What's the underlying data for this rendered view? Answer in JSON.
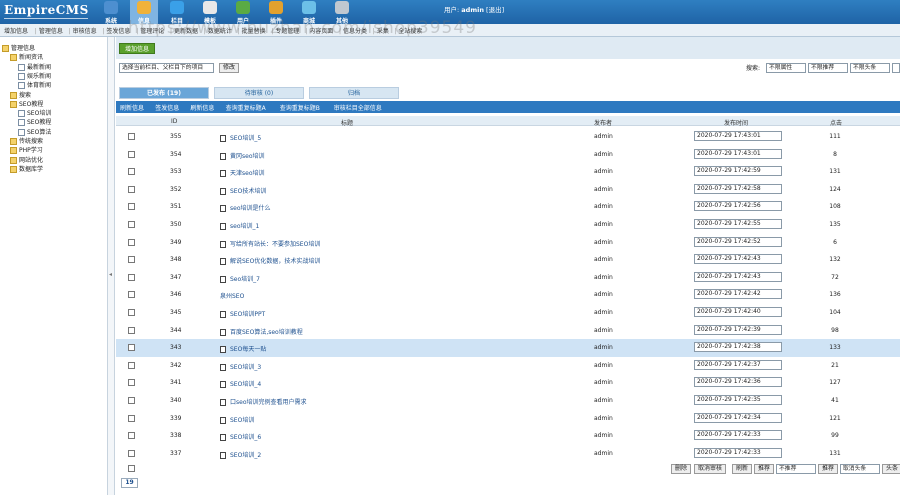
{
  "app": {
    "logo": "EmpireCMS",
    "watermark": "https://www.huzhan.com/ishop39549"
  },
  "nav": [
    {
      "label": "系统",
      "icon": "system-icon",
      "color": "#4d8fd0"
    },
    {
      "label": "信息",
      "icon": "info-edit-icon",
      "color": "#f0b23a"
    },
    {
      "label": "栏目",
      "icon": "column-icon",
      "color": "#3aa0e8"
    },
    {
      "label": "模板",
      "icon": "template-icon",
      "color": "#e8e8e8"
    },
    {
      "label": "用户",
      "icon": "user-icon",
      "color": "#5aaa44"
    },
    {
      "label": "插件",
      "icon": "plugin-icon",
      "color": "#e2a12e"
    },
    {
      "label": "商城",
      "icon": "shop-icon",
      "color": "#6cc0e8"
    },
    {
      "label": "其他",
      "icon": "other-icon",
      "color": "#c0c8d0"
    }
  ],
  "user": {
    "prefix": "用户:",
    "name": "admin",
    "logout": "[退出]"
  },
  "subtabs": [
    "增加信息",
    "管理信息",
    "审核信息",
    "签发信息",
    "管理评论",
    "更新数据",
    "数据统计",
    "批量替换",
    "专题管理",
    "内容页面",
    "信息分类",
    "采集",
    "全站搜索"
  ],
  "sidebar": [
    {
      "label": "管理信息",
      "level": 0,
      "icon": "manage-icon"
    },
    {
      "label": "新闻资讯",
      "level": 1,
      "icon": "folder-icon"
    },
    {
      "label": "最新新闻",
      "level": 2,
      "icon": "doc-icon"
    },
    {
      "label": "娱乐新闻",
      "level": 2,
      "icon": "doc-icon"
    },
    {
      "label": "体育新闻",
      "level": 2,
      "icon": "doc-icon"
    },
    {
      "label": "搜索",
      "level": 1,
      "icon": "folder-icon"
    },
    {
      "label": "SEO教程",
      "level": 1,
      "icon": "folder-icon"
    },
    {
      "label": "SEO培训",
      "level": 2,
      "icon": "doc-icon"
    },
    {
      "label": "SEO教程",
      "level": 2,
      "icon": "doc-icon"
    },
    {
      "label": "SEO算法",
      "level": 2,
      "icon": "doc-icon"
    },
    {
      "label": "传统搜索",
      "level": 1,
      "icon": "folder-icon"
    },
    {
      "label": "PHP学习",
      "level": 1,
      "icon": "folder-icon"
    },
    {
      "label": "网站优化",
      "level": 1,
      "icon": "folder-icon"
    },
    {
      "label": "数据库学",
      "level": 1,
      "icon": "folder-icon"
    }
  ],
  "toolbar": {
    "add_label": "增加信息"
  },
  "filter": {
    "column_select": "选择当前栏目、父栏目下的项目",
    "column_btn": "修改",
    "search_label": "搜索:",
    "attr_select": "不限属性",
    "state_select": "不限推荐",
    "head_select": "不限头条"
  },
  "state_tabs": [
    "已发布 (19)",
    "待审核 (0)",
    "归档"
  ],
  "actions": [
    "刷新信息",
    "签发信息",
    "刷新信息",
    "查询重复标题A",
    "查询重复标题B",
    "审核栏目全部信息"
  ],
  "table": {
    "headers": {
      "id": "ID",
      "title": "标题",
      "author": "发布者",
      "time": "发布时间",
      "hits": "点击"
    },
    "rows": [
      {
        "id": "355",
        "title": "SEO培训_5",
        "author": "admin",
        "time": "2020-07-29 17:43:01",
        "hits": "111",
        "hl": false,
        "doc": true
      },
      {
        "id": "354",
        "title": "黄冈seo培训",
        "author": "admin",
        "time": "2020-07-29 17:43:01",
        "hits": "8",
        "hl": false,
        "doc": true
      },
      {
        "id": "353",
        "title": "天津seo培训",
        "author": "admin",
        "time": "2020-07-29 17:42:59",
        "hits": "131",
        "hl": false,
        "doc": true
      },
      {
        "id": "352",
        "title": "SEO技术培训",
        "author": "admin",
        "time": "2020-07-29 17:42:58",
        "hits": "124",
        "hl": false,
        "doc": true
      },
      {
        "id": "351",
        "title": "seo培训是什么",
        "author": "admin",
        "time": "2020-07-29 17:42:56",
        "hits": "108",
        "hl": false,
        "doc": true
      },
      {
        "id": "350",
        "title": "seo培训_1",
        "author": "admin",
        "time": "2020-07-29 17:42:55",
        "hits": "135",
        "hl": false,
        "doc": true
      },
      {
        "id": "349",
        "title": "写给所有站长：不要参加SEO培训",
        "author": "admin",
        "time": "2020-07-29 17:42:52",
        "hits": "6",
        "hl": false,
        "doc": true
      },
      {
        "id": "348",
        "title": "解说SEO优化数据，技术实战培训",
        "author": "admin",
        "time": "2020-07-29 17:42:43",
        "hits": "132",
        "hl": false,
        "doc": true
      },
      {
        "id": "347",
        "title": "Seo培训_7",
        "author": "admin",
        "time": "2020-07-29 17:42:43",
        "hits": "72",
        "hl": false,
        "doc": true
      },
      {
        "id": "346",
        "title": "泉州SEO",
        "author": "admin",
        "time": "2020-07-29 17:42:42",
        "hits": "136",
        "hl": false,
        "doc": false
      },
      {
        "id": "345",
        "title": "SEO培训PPT",
        "author": "admin",
        "time": "2020-07-29 17:42:40",
        "hits": "104",
        "hl": false,
        "doc": true
      },
      {
        "id": "344",
        "title": "百度SEO算法,seo培训教程",
        "author": "admin",
        "time": "2020-07-29 17:42:39",
        "hits": "98",
        "hl": false,
        "doc": true
      },
      {
        "id": "343",
        "title": "SEO每天一贴",
        "author": "admin",
        "time": "2020-07-29 17:42:38",
        "hits": "133",
        "hl": true,
        "doc": true
      },
      {
        "id": "342",
        "title": "SEO培训_3",
        "author": "admin",
        "time": "2020-07-29 17:42:37",
        "hits": "21",
        "hl": false,
        "doc": true
      },
      {
        "id": "341",
        "title": "SEO培训_4",
        "author": "admin",
        "time": "2020-07-29 17:42:36",
        "hits": "127",
        "hl": false,
        "doc": true
      },
      {
        "id": "340",
        "title": "口seo培训完例查看用户需求",
        "author": "admin",
        "time": "2020-07-29 17:42:35",
        "hits": "41",
        "hl": false,
        "doc": true
      },
      {
        "id": "339",
        "title": "SEO培训",
        "author": "admin",
        "time": "2020-07-29 17:42:34",
        "hits": "121",
        "hl": false,
        "doc": true
      },
      {
        "id": "338",
        "title": "SEO培训_6",
        "author": "admin",
        "time": "2020-07-29 17:42:33",
        "hits": "99",
        "hl": false,
        "doc": true
      },
      {
        "id": "337",
        "title": "SEO培训_2",
        "author": "admin",
        "time": "2020-07-29 17:42:33",
        "hits": "131",
        "hl": false,
        "doc": true
      }
    ]
  },
  "bottom": {
    "delete": "删除",
    "unaudit": "取消审核",
    "refresh": "刷新",
    "push": "推荐",
    "move_select": "不推荐",
    "move_btn": "推荐",
    "head_select": "取消头条",
    "head_btn": "头条"
  },
  "pager": {
    "count": "19"
  }
}
